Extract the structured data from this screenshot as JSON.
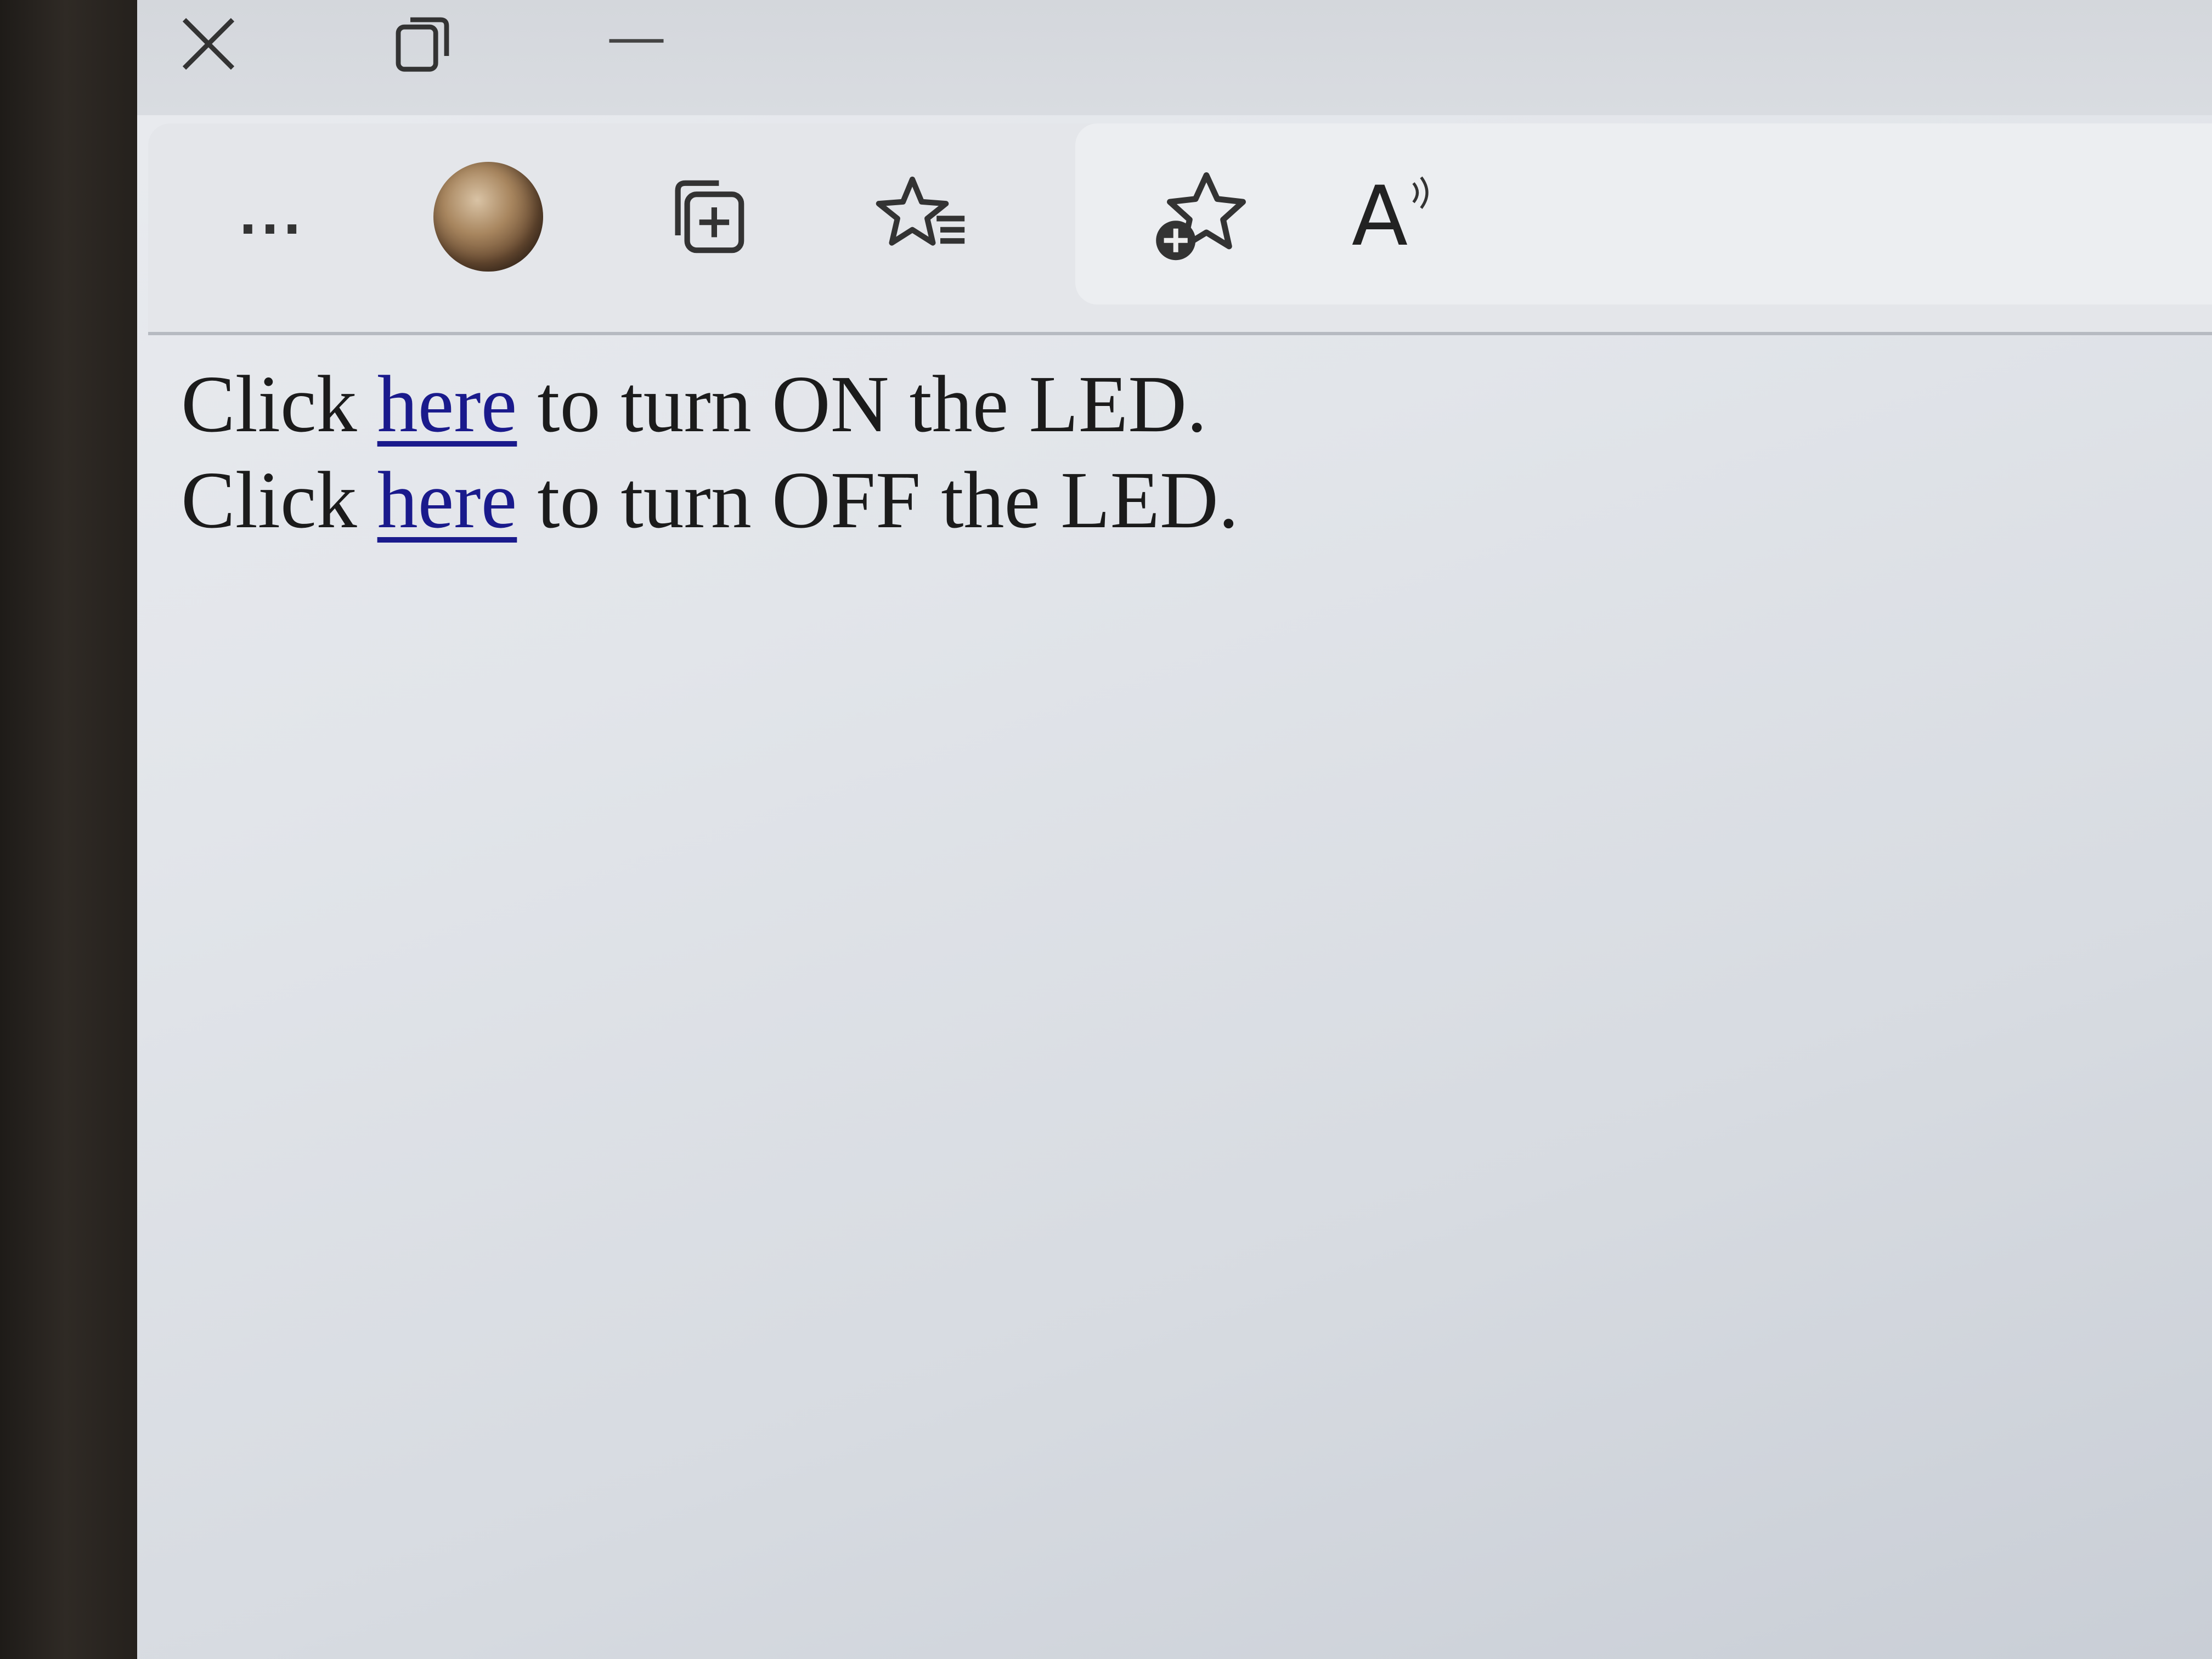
{
  "window_controls": {
    "close_icon": "close-icon",
    "restore_icon": "restore-icon",
    "minimize_icon": "minimize-icon"
  },
  "toolbar": {
    "more_label": "...",
    "profile_icon": "avatar",
    "collections_icon": "collections-add-icon",
    "favorites_icon": "favorites-list-icon",
    "add_favorite_icon": "add-favorite-icon",
    "read_aloud_label": "A"
  },
  "content": {
    "line1": {
      "prefix": "Click ",
      "link": "here",
      "suffix": " to turn ON the LED."
    },
    "line2": {
      "prefix": "Click ",
      "link": "here",
      "suffix": " to turn OFF the LED."
    }
  },
  "colors": {
    "link": "#1a1a8c",
    "text": "#1b1b1b",
    "background": "#e2e5ea"
  }
}
